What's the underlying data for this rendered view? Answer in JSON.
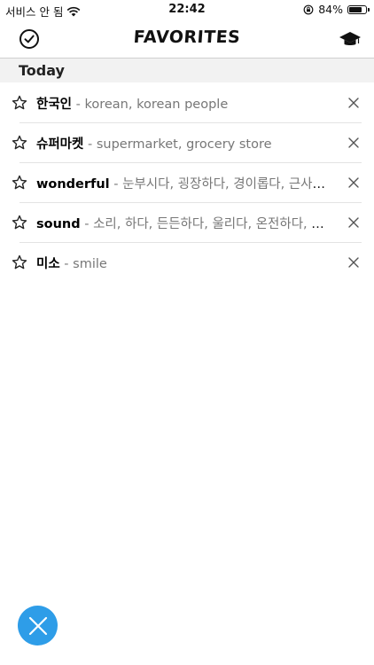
{
  "status_bar": {
    "carrier": "서비스 안 됨",
    "time": "22:42",
    "battery_text": "84%",
    "battery_level": 0.84
  },
  "nav": {
    "title": "FAVORITES"
  },
  "section": {
    "label": "Today"
  },
  "favorites": [
    {
      "word": "한국인",
      "definition": "korean, korean people"
    },
    {
      "word": "슈퍼마켓",
      "definition": "supermarket, grocery store"
    },
    {
      "word": "wonderful",
      "definition": "눈부시다, 굉장하다, 경이롭다, 근사하다, 훌륭하다"
    },
    {
      "word": "sound",
      "definition": "소리, 하다, 든든하다, 울리다, 온전하다, 음향, 건전하다"
    },
    {
      "word": "미소",
      "definition": "smile"
    }
  ],
  "separator": " - ",
  "colors": {
    "fab": "#2e9de8",
    "header_bg": "#f2f2f2"
  },
  "icons": {
    "nav_left": "check-circle-icon",
    "nav_right": "graduation-cap-icon",
    "row_left": "star-outline-icon",
    "row_right": "close-icon",
    "fab": "close-icon"
  }
}
